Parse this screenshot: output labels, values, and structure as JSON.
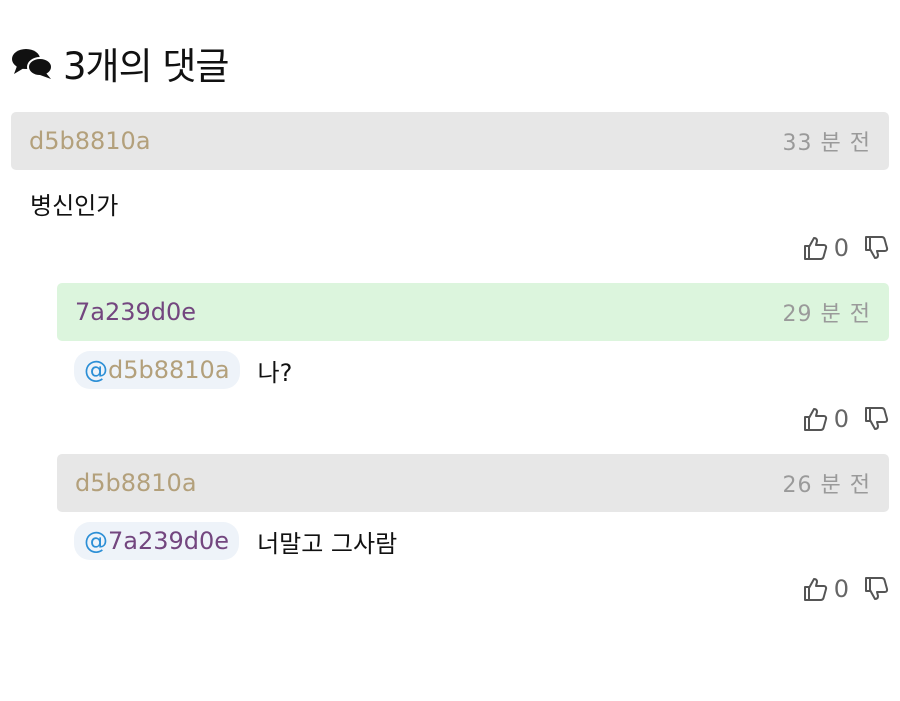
{
  "header": {
    "title": "3개의 댓글",
    "icon": "chat-bubbles-icon"
  },
  "comments": [
    {
      "author": "d5b8810a",
      "time": "33 분 전",
      "text": "병신인가",
      "likes": "0",
      "bar_color": "#e7e7e7",
      "author_color": "#b3a07b"
    },
    {
      "author": "7a239d0e",
      "time": "29 분 전",
      "mention_at": "@",
      "mention": "d5b8810a",
      "text": "나?",
      "likes": "0",
      "bar_color": "#dcf5dd",
      "author_color": "#73467f"
    },
    {
      "author": "d5b8810a",
      "time": "26 분 전",
      "mention_at": "@",
      "mention": "7a239d0e",
      "text": "너말고 그사람",
      "likes": "0",
      "bar_color": "#e7e7e7",
      "author_color": "#b3a07b"
    }
  ],
  "colors": {
    "mention_at": "#2c8fd6",
    "mention_bg": "#eef3f9",
    "time": "#9a9a9a"
  }
}
